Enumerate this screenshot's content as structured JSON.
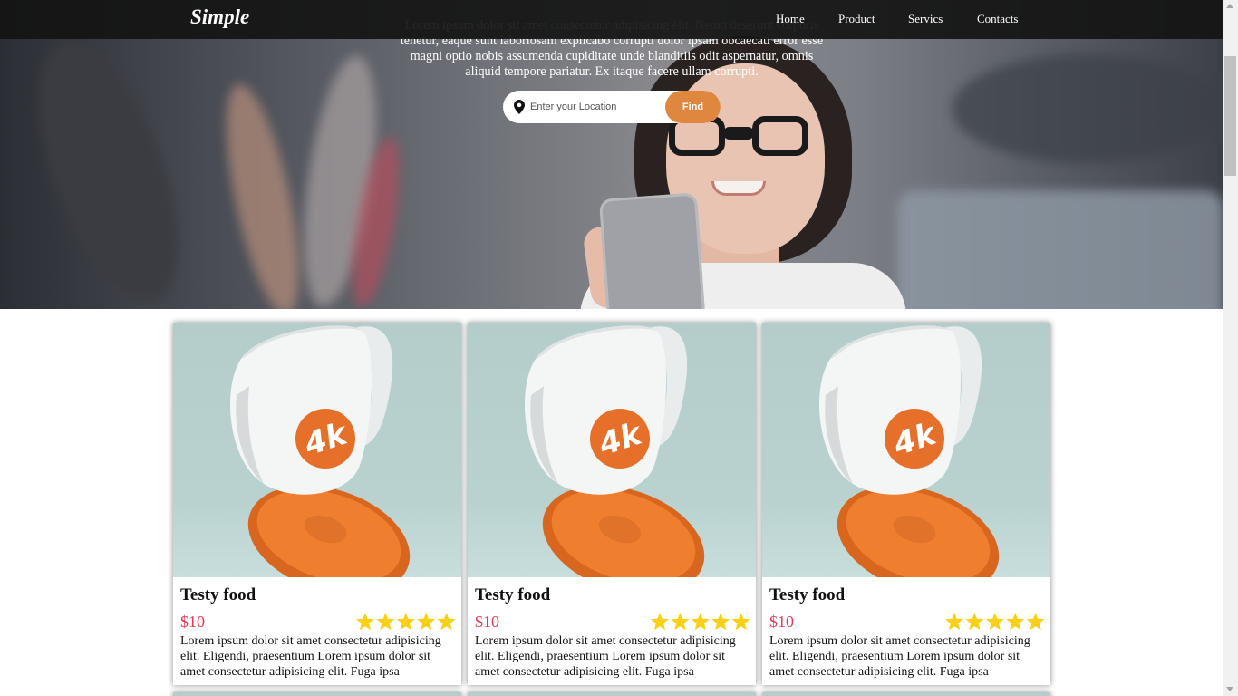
{
  "nav": {
    "logo": "Simple",
    "items": [
      {
        "label": "Home"
      },
      {
        "label": "Product"
      },
      {
        "label": "Servics"
      },
      {
        "label": "Contacts"
      }
    ]
  },
  "hero": {
    "text": "Lorem ipsum dolor sit amet consectetur adipisicing elit. Nemo deserunt corporis tenetur, eaque sunt laboriosam explicabo corrupti dolor ipsam obcaecati error esse magni optio nobis assumenda cupiditate unde blanditiis odit aspernatur, omnis aliquid tempore pariatur. Ex itaque facere ullam corrupti.",
    "search": {
      "placeholder": "Enter your Location",
      "button": "Find"
    }
  },
  "cards": [
    {
      "title": "Testy food",
      "price": "$10",
      "rating": 5,
      "description": "Lorem ipsum dolor sit amet consectetur adipisicing elit. Eligendi, praesentium Lorem ipsum dolor sit amet consectetur adipisicing elit. Fuga ipsa"
    },
    {
      "title": "Testy food",
      "price": "$10",
      "rating": 5,
      "description": "Lorem ipsum dolor sit amet consectetur adipisicing elit. Eligendi, praesentium Lorem ipsum dolor sit amet consectetur adipisicing elit. Fuga ipsa"
    },
    {
      "title": "Testy food",
      "price": "$10",
      "rating": 5,
      "description": "Lorem ipsum dolor sit amet consectetur adipisicing elit. Eligendi, praesentium Lorem ipsum dolor sit amet consectetur adipisicing elit. Fuga ipsa"
    }
  ],
  "colors": {
    "accent": "#e0873f",
    "price": "#e8384f",
    "star": "#f8d114",
    "nav_bg": "#141414"
  },
  "icons": {
    "location": "location-pin-icon",
    "star": "star-icon"
  }
}
